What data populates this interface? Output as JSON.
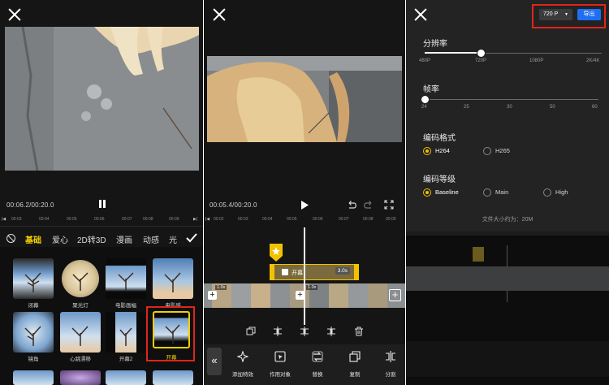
{
  "panel1": {
    "close_icon": "close-icon",
    "timecode": "00:06.2/00:20.0",
    "ruler": [
      "00:03",
      "00:04",
      "00:05",
      "00:06",
      "00:07",
      "00:08",
      "00:09"
    ],
    "categories": [
      "基础",
      "爱心",
      "2D转3D",
      "漫画",
      "动感",
      "光"
    ],
    "effects_row1": [
      "闭幕",
      "聚光灯",
      "电影画幅",
      "电影感"
    ],
    "effects_row2": [
      "镜角",
      "心跳漂移",
      "开幕2",
      "开幕"
    ],
    "selected_effect": "开幕",
    "accent": "#f2d000",
    "highlight": "#e0251b"
  },
  "panel2": {
    "timecode": "00:05.4/00:20.0",
    "ruler": [
      "00:02",
      "00:03",
      "00:04",
      "00:05",
      "00:06",
      "00:07",
      "00:08",
      "00:09"
    ],
    "effect_clip_label": "开幕",
    "effect_clip_duration": "3.0s",
    "clip_speed_1": "1.0x",
    "clip_speed_2": "1.0x",
    "tools": [
      "添加特效",
      "作用对象",
      "替换",
      "复制",
      "分割"
    ]
  },
  "panel3": {
    "resolution_button": "720 P",
    "export_button": "导出",
    "resolution_title": "分辨率",
    "resolution_ticks": [
      "480P",
      "720P",
      "1080P",
      "2K/4K"
    ],
    "resolution_value": "720P",
    "framerate_title": "帧率",
    "framerate_ticks": [
      "24",
      "25",
      "30",
      "50",
      "60"
    ],
    "framerate_value": "24",
    "codec_title": "编码格式",
    "codec_options": [
      "H264",
      "H265"
    ],
    "codec_selected": "H264",
    "level_title": "编码等级",
    "level_options": [
      "Baseline",
      "Main",
      "High"
    ],
    "level_selected": "Baseline",
    "filesize": "文件大小约为：20M"
  }
}
